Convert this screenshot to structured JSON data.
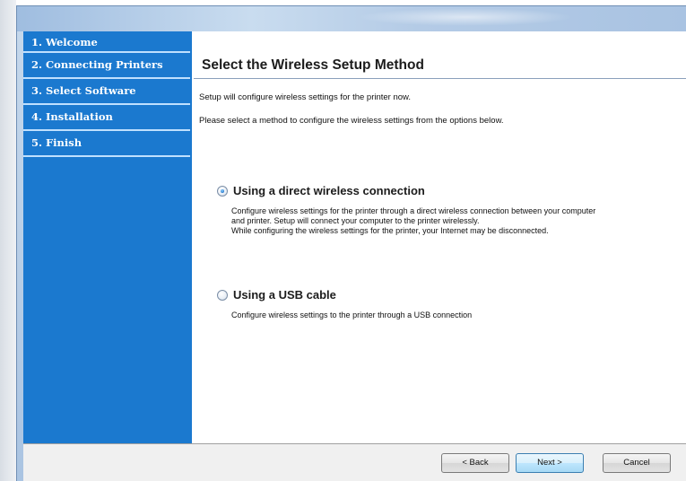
{
  "sidebar": {
    "steps": [
      {
        "label": "1. Welcome"
      },
      {
        "label": "2. Connecting Printers"
      },
      {
        "label": "3. Select Software"
      },
      {
        "label": "4. Installation"
      },
      {
        "label": "5. Finish"
      }
    ]
  },
  "main": {
    "title": "Select the Wireless Setup Method",
    "desc1": "Setup will configure wireless settings for the printer now.",
    "desc2": "Please select a method to configure the wireless settings from the options below.",
    "options": [
      {
        "label": "Using a direct wireless connection",
        "selected": true,
        "desc_lines": [
          "Configure wireless settings for the printer through a direct wireless connection between your computer",
          "and printer. Setup will connect your computer to the printer wirelessly.",
          "While configuring the wireless settings for the printer, your Internet may be disconnected."
        ]
      },
      {
        "label": "Using a USB cable",
        "selected": false,
        "desc_lines": [
          "Configure wireless settings to the printer through a USB connection"
        ]
      }
    ]
  },
  "footer": {
    "back_label": "< Back",
    "next_label": "Next >",
    "cancel_label": "Cancel"
  },
  "colors": {
    "sidebar": "#1b79cf",
    "sidebar_divider": "#bfe0ff"
  }
}
